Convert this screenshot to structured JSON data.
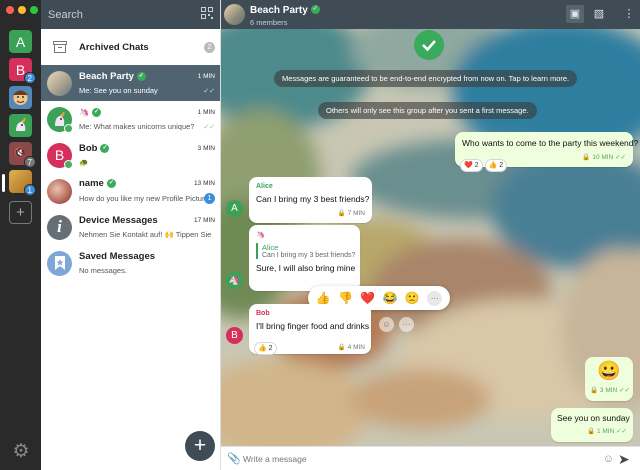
{
  "window_controls": {
    "colors": [
      "#ff5f57",
      "#febc2e",
      "#28c840"
    ]
  },
  "accounts": [
    {
      "letter": "A",
      "color": "#3aa157",
      "badge": ""
    },
    {
      "letter": "B",
      "color": "#d5305b",
      "badge": "2"
    },
    {
      "letter": "",
      "color": "#5487b5",
      "badge": ""
    },
    {
      "letter": "",
      "color": "#3aa157",
      "badge": ""
    },
    {
      "letter": "",
      "color": "#8b4a4a",
      "badge": "7"
    },
    {
      "letter": "",
      "color": "#c9913a",
      "badge": "1"
    }
  ],
  "add_account_label": "+",
  "list": {
    "search_label": "Search",
    "archived": {
      "label": "Archived Chats",
      "count": "2"
    },
    "chats": [
      {
        "name": "Beach Party",
        "time": "1 MIN",
        "preview": "Me: See you on sunday",
        "verified": true,
        "selected": true,
        "tick": "✓✓",
        "avatar_letter": "",
        "avatar_color": "#b3a890",
        "unread": ""
      },
      {
        "name": "",
        "time": "1 MIN",
        "preview": "Me: What makes unicorns unique?",
        "verified": true,
        "selected": false,
        "tick": "✓✓",
        "avatar_letter": "",
        "avatar_color": "#3aa157",
        "unread": ""
      },
      {
        "name": "Bob",
        "time": "3 MIN",
        "preview": "",
        "verified": true,
        "selected": false,
        "tick": "",
        "avatar_letter": "B",
        "avatar_color": "#d5305b",
        "unread": ""
      },
      {
        "name": "name",
        "time": "13 MIN",
        "preview": "How do you like my new Profile Pictur",
        "verified": true,
        "selected": false,
        "tick": "",
        "avatar_letter": "",
        "avatar_color": "#b5665a",
        "unread": "1"
      },
      {
        "name": "Device Messages",
        "time": "17 MIN",
        "preview": "Nehmen Sie Kontakt auf! 🙌 Tippen Sie",
        "verified": false,
        "selected": false,
        "tick": "",
        "avatar_letter": "i",
        "avatar_color": "#666f76",
        "unread": ""
      },
      {
        "name": "Saved Messages",
        "time": "",
        "preview": "No messages.",
        "verified": false,
        "selected": false,
        "tick": "",
        "avatar_letter": "★",
        "avatar_color": "#7ea7d8",
        "unread": ""
      }
    ],
    "fab_label": "+"
  },
  "chat": {
    "title": "Beach Party",
    "subtitle": "6 members",
    "system_messages": [
      "Messages are guaranteed to be end-to-end encrypted from now on. Tap to learn more.",
      "Others will only see this group after you sent a first message."
    ],
    "messages": [
      {
        "sender": "",
        "text": "Who wants to come to the party this weekend?",
        "time": "10 MIN",
        "reactions": [
          {
            "emoji": "❤️",
            "count": "2"
          },
          {
            "emoji": "👍",
            "count": "2"
          }
        ]
      },
      {
        "sender": "Alice",
        "text": "Can I bring my 3 best friends?",
        "time": "7 MIN",
        "reactions": []
      },
      {
        "sender": "",
        "quote_sender": "Alice",
        "quote_text": "Can I bring my 3 best friends?",
        "text": "Sure, I will also bring mine",
        "time": "7 MIN",
        "reactions": []
      },
      {
        "sender": "Bob",
        "text": "I'll bring finger food and drinks",
        "time": "4 MIN",
        "reactions": [
          {
            "emoji": "👍",
            "count": "2"
          }
        ]
      },
      {
        "sender": "",
        "text": "😀",
        "time": "3 MIN",
        "reactions": []
      },
      {
        "sender": "",
        "text": "See you on sunday",
        "time": "1 MIN",
        "reactions": []
      }
    ],
    "reaction_picker": [
      "👍",
      "👎",
      "❤️",
      "😂",
      "🙁",
      "···"
    ],
    "composer_placeholder": "Write a message"
  }
}
